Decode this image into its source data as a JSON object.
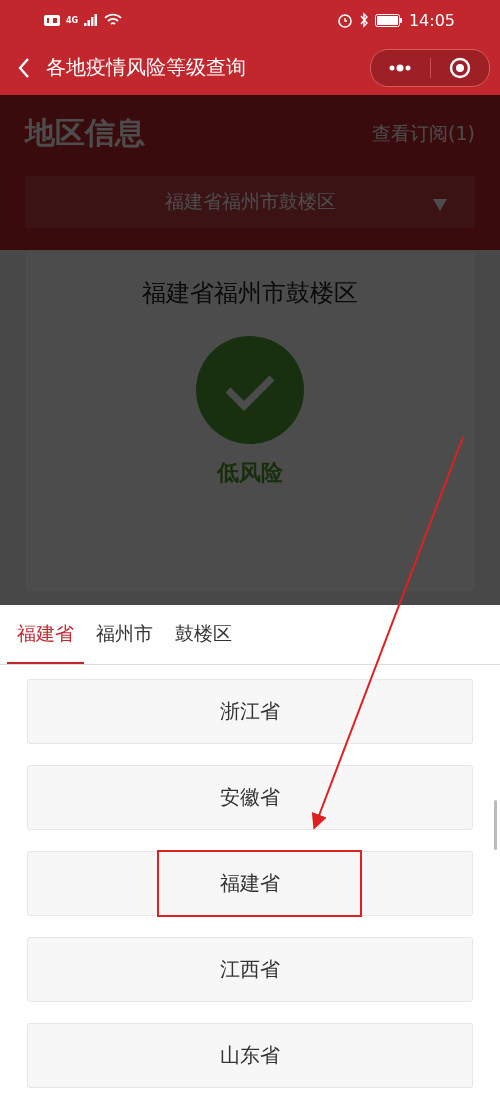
{
  "status_bar": {
    "network": "4G",
    "time": "14:05"
  },
  "nav": {
    "title": "各地疫情风险等级查询"
  },
  "page": {
    "title": "地区信息",
    "subscriptions_link": "查看订阅(1)",
    "region_select": {
      "value": "福建省福州市鼓楼区"
    },
    "card": {
      "region": "福建省福州市鼓楼区",
      "risk_level": "低风险"
    }
  },
  "picker": {
    "tabs": [
      {
        "label": "福建省",
        "selected": true
      },
      {
        "label": "福州市",
        "selected": false
      },
      {
        "label": "鼓楼区",
        "selected": false
      }
    ],
    "options": [
      {
        "label": "浙江省",
        "highlighted": false
      },
      {
        "label": "安徽省",
        "highlighted": false
      },
      {
        "label": "福建省",
        "highlighted": true
      },
      {
        "label": "江西省",
        "highlighted": false
      },
      {
        "label": "山东省",
        "highlighted": false
      }
    ]
  }
}
